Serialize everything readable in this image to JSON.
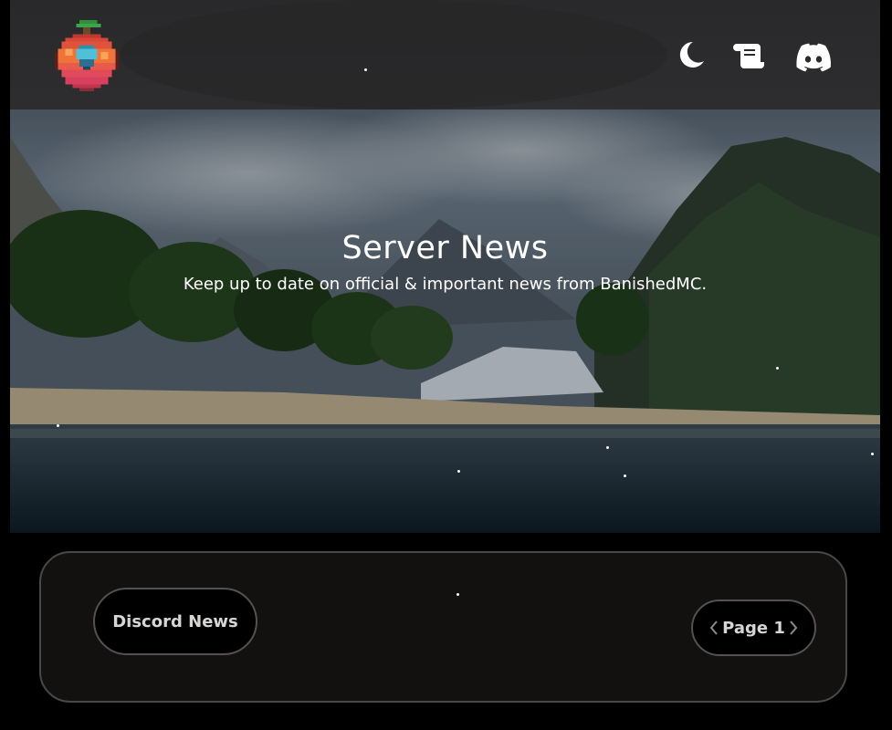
{
  "navbar": {
    "logo_alt": "BanishedMC logo",
    "icons": {
      "theme": "moon-icon",
      "rules": "scroll-icon",
      "discord": "discord-icon"
    }
  },
  "hero": {
    "title": "Server News",
    "subtitle": "Keep up to date on official & important news from BanishedMC."
  },
  "news": {
    "discord_news_label": "Discord News",
    "pagination": {
      "label": "Page 1",
      "prev_icon": "chevron-left-icon",
      "next_icon": "chevron-right-icon"
    }
  },
  "colors": {
    "background": "#000000",
    "navbar": "#282626",
    "panel": "#131110",
    "panel_border": "#4a4847",
    "button_text": "#d8d6d4",
    "hero_text": "#ffffff"
  }
}
